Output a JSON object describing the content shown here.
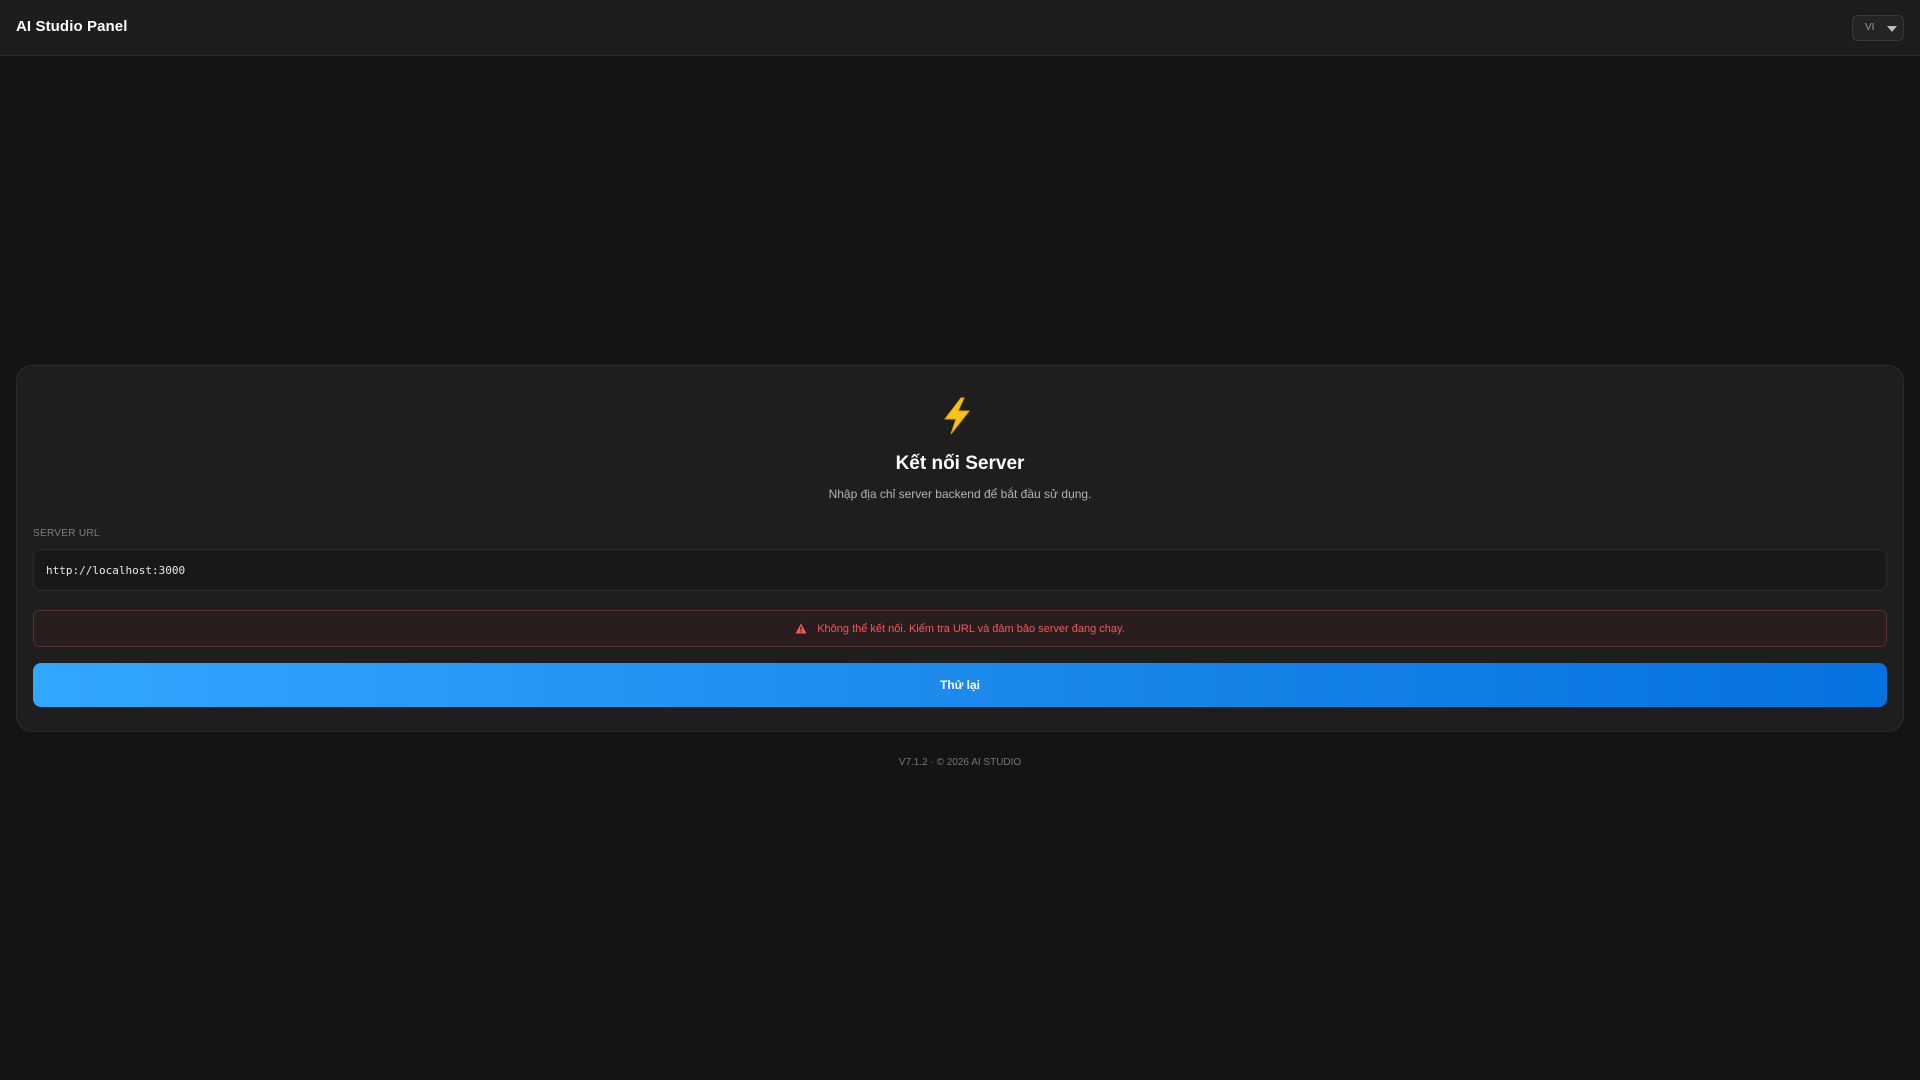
{
  "header": {
    "app_title": "AI Studio Panel",
    "language": {
      "selected": "VI"
    }
  },
  "connect_card": {
    "icon": "lightning-bolt-icon",
    "title": "Kết nối Server",
    "subtitle": "Nhập địa chỉ server backend để bắt đầu sử dụng.",
    "server_url_label": "SERVER URL",
    "server_url_value": "http://localhost:3000",
    "error": {
      "icon": "warning-icon",
      "message": "Không thể kết nối. Kiểm tra URL và đảm bảo server đang chạy."
    },
    "retry_button_label": "Thử lại"
  },
  "footer": {
    "text": "V7.1.2 · © 2026 AI STUDIO"
  },
  "colors": {
    "background": "#141414",
    "card": "#1e1e1e",
    "accent_start": "#33a6ff",
    "accent_end": "#0671e0",
    "error": "#f05a5a",
    "bolt": "#f5c518"
  }
}
